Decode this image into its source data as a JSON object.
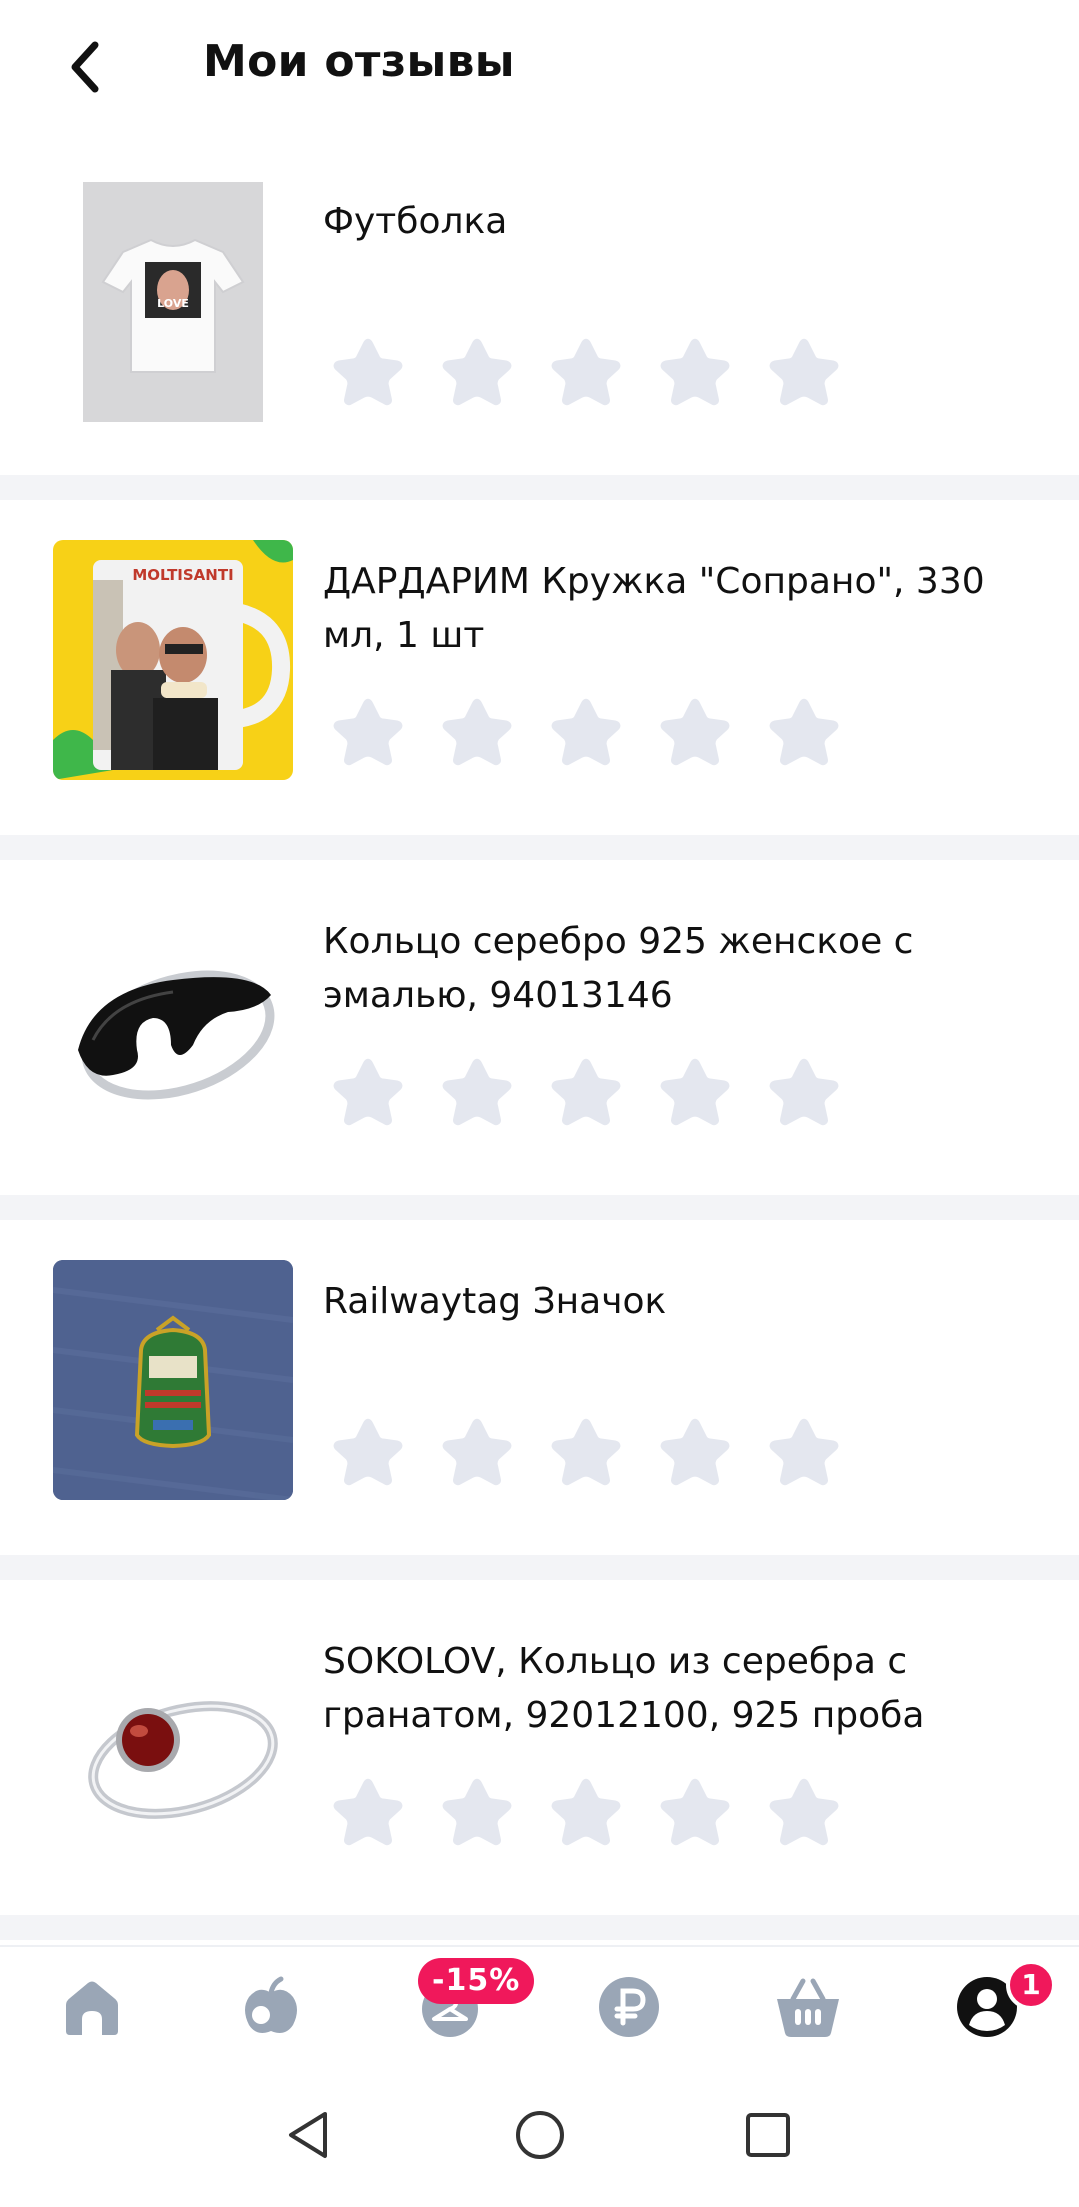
{
  "header": {
    "title": "Мои отзывы"
  },
  "products": [
    {
      "name": "Футболка",
      "rating": 0
    },
    {
      "name": "ДАРДАРИМ Кружка \"Сопрано\", 330 мл, 1 шт",
      "rating": 0
    },
    {
      "name": "Кольцо серебро 925 женское с эмалью, 94013146",
      "rating": 0
    },
    {
      "name": "Railwaytag Значок",
      "rating": 0
    },
    {
      "name": "SOKOLOV, Кольцо из серебра с гранатом, 92012100, 925 проба",
      "rating": 0
    }
  ],
  "mug_print": {
    "label": "MOLTISANTI"
  },
  "tshirt_print": {
    "label": "LOVE"
  },
  "bottom_nav": {
    "discount_badge": "-15%",
    "profile_badge": "1",
    "items": [
      "home-icon",
      "apple-icon",
      "hanger-icon",
      "ruble-icon",
      "basket-icon",
      "profile-icon"
    ]
  },
  "colors": {
    "accent": "#f0185b",
    "star_empty": "#e4e7ef",
    "nav_icon": "#9aa6b6",
    "nav_active": "#111111",
    "separator": "#f3f4f7"
  }
}
